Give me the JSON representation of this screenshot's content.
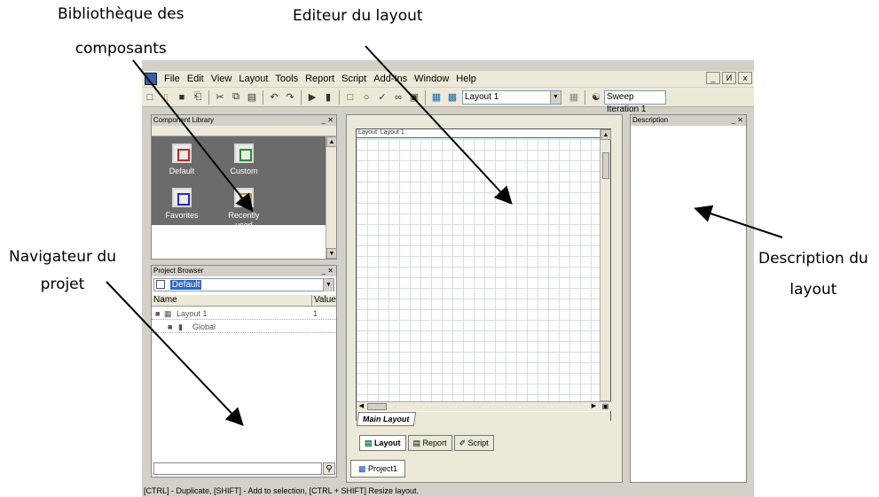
{
  "annotations": {
    "library": [
      "Bibliothèque des",
      "composants"
    ],
    "editor": "Editeur du layout",
    "navigator": [
      "Navigateur du",
      "projet"
    ],
    "description": [
      "Description du",
      "layout"
    ]
  },
  "menu": [
    "File",
    "Edit",
    "View",
    "Layout",
    "Tools",
    "Report",
    "Script",
    "Add-Ins",
    "Window",
    "Help"
  ],
  "window_buttons": {
    "min": "_",
    "max": "И",
    "close": "x"
  },
  "toolbar": {
    "layout_combo": "Layout 1",
    "sweep_combo": "Sweep Iteration 1"
  },
  "component_library": {
    "title": "Component Library",
    "items": [
      {
        "label": "Default",
        "icon": "folder-red-icon",
        "color": "#c0282a"
      },
      {
        "label": "Custom",
        "icon": "folder-green-icon",
        "color": "#2a8a30"
      },
      {
        "label": "Favorites",
        "icon": "folder-blue-icon",
        "color": "#2a2ab0"
      },
      {
        "label": "Recently used",
        "icon": "folder-yellow-icon",
        "color": "#b0a020"
      }
    ]
  },
  "project_browser": {
    "title": "Project Browser",
    "selected": "Default",
    "columns": [
      "Name",
      "Value"
    ],
    "rows": [
      {
        "name": "Layout 1",
        "value": "1"
      },
      {
        "name": "Global",
        "value": ""
      }
    ]
  },
  "layout_editor": {
    "header": "Layout: Layout 1",
    "sheet_tab": "Main Layout",
    "view_tabs": [
      "Layout",
      "Report",
      "Script"
    ],
    "project_tab": "Project1"
  },
  "description_panel": {
    "title": "Description"
  },
  "status_bar": "[CTRL] - Duplicate, [SHIFT] - Add to selection, [CTRL + SHIFT] Resize layout."
}
